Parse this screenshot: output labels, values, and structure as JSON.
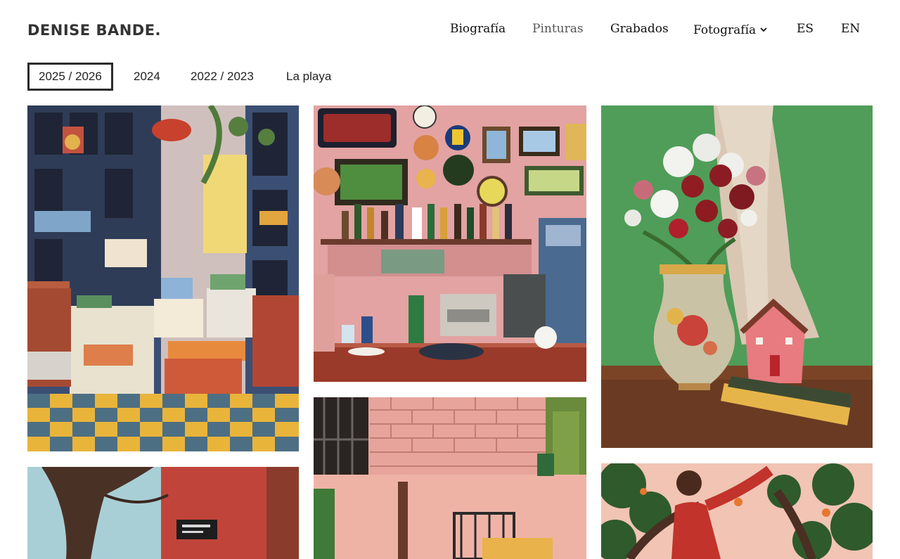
{
  "brand": {
    "name": "DENISE BANDE."
  },
  "nav": {
    "items": [
      {
        "label": "Biografía"
      },
      {
        "label": "Pinturas"
      },
      {
        "label": "Grabados"
      },
      {
        "label": "Fotografía"
      },
      {
        "label": "ES"
      },
      {
        "label": "EN"
      }
    ]
  },
  "tabs": {
    "items": [
      {
        "label": "2025 / 2026",
        "active": true
      },
      {
        "label": "2024"
      },
      {
        "label": "2022 / 2023"
      },
      {
        "label": "La playa"
      }
    ]
  },
  "gallery": {
    "paintings": [
      {
        "subject": "interior-boxes"
      },
      {
        "subject": "bar-restaurant"
      },
      {
        "subject": "flowers-vase"
      },
      {
        "subject": "tree-wall"
      },
      {
        "subject": "brick-courtyard"
      },
      {
        "subject": "red-figure-tree"
      }
    ]
  },
  "colors": {
    "accent_border": "#2b2b2b",
    "text": "#1d1d1d"
  }
}
